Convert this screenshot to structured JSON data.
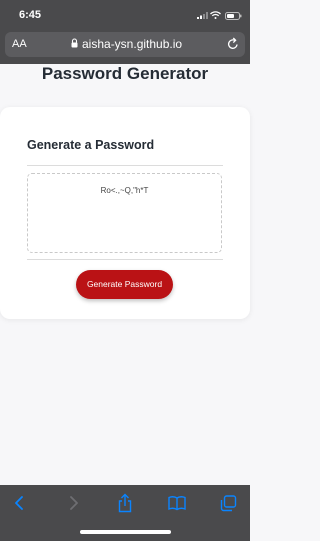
{
  "status_bar": {
    "time": "6:45"
  },
  "browser": {
    "text_size_label": "AA",
    "url": "aisha-ysn.github.io",
    "icons": [
      "lock-icon",
      "reload-icon",
      "back-icon",
      "forward-icon",
      "share-icon",
      "bookmarks-icon",
      "tabs-icon"
    ]
  },
  "page": {
    "title": "Password Generator",
    "card": {
      "heading": "Generate a Password",
      "password_value": "Ro<.,~Q,\"h*T",
      "button_label": "Generate Password"
    }
  },
  "colors": {
    "browser_chrome": "#4a4a4c",
    "url_field": "#5c5c5f",
    "accent_button": "#ba1215",
    "toolbar_icon": "#0a84ff",
    "toolbar_icon_disabled": "#6e6e72",
    "heading_text": "#252c35"
  }
}
